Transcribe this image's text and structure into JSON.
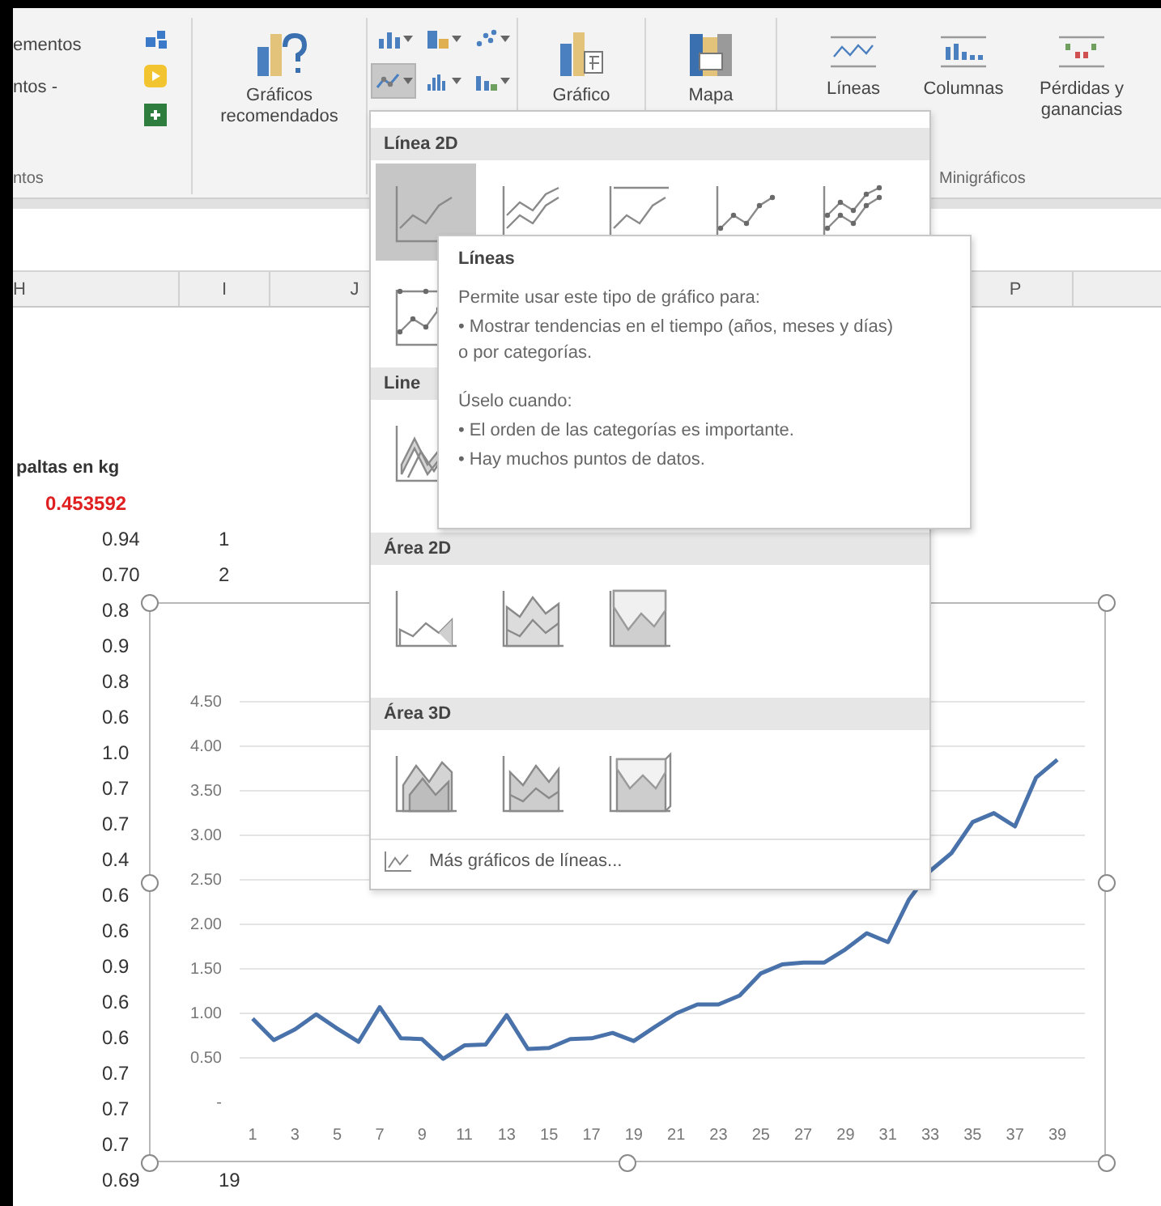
{
  "ribbon": {
    "partial_group": {
      "items": [
        "ementos",
        "ntos -"
      ],
      "label": "ntos"
    },
    "recommended_button": {
      "label": "Gráficos recomendados"
    },
    "chart_type_buttons": [
      {
        "kind": "column",
        "selected": false
      },
      {
        "kind": "hierarchy",
        "selected": false
      },
      {
        "kind": "scatter",
        "selected": false
      },
      {
        "kind": "line",
        "selected": true
      },
      {
        "kind": "statistic",
        "selected": false
      },
      {
        "kind": "combo",
        "selected": false
      }
    ],
    "pivot_chart_button": {
      "label": "Gráfico"
    },
    "map_button": {
      "label": "Mapa"
    },
    "sparklines": {
      "buttons": [
        {
          "kind": "line",
          "label": "Líneas"
        },
        {
          "kind": "column",
          "label": "Columnas"
        },
        {
          "kind": "win_loss",
          "label": "Pérdidas y ganancias"
        }
      ],
      "label": "Minigráficos"
    }
  },
  "column_headers": [
    "H",
    "I",
    "J",
    "P"
  ],
  "sheet": {
    "title_cell": "paltas en kg",
    "factor_cell": "0.453592",
    "rows": [
      {
        "value": "0.94",
        "number": "1"
      },
      {
        "value": "0.70",
        "number": "2"
      },
      {
        "value": "0.8"
      },
      {
        "value": "0.9"
      },
      {
        "value": "0.8"
      },
      {
        "value": "0.6"
      },
      {
        "value": "1.0"
      },
      {
        "value": "0.7"
      },
      {
        "value": "0.7"
      },
      {
        "value": "0.4"
      },
      {
        "value": "0.6"
      },
      {
        "value": "0.6"
      },
      {
        "value": "0.9"
      },
      {
        "value": "0.6"
      },
      {
        "value": "0.6"
      },
      {
        "value": "0.7"
      },
      {
        "value": "0.7"
      },
      {
        "value": "0.7"
      },
      {
        "value": "0.69",
        "number": "19"
      }
    ]
  },
  "chart": {
    "chart_data": {
      "type": "line",
      "x": [
        1,
        2,
        3,
        4,
        5,
        6,
        7,
        8,
        9,
        10,
        11,
        12,
        13,
        14,
        15,
        16,
        17,
        18,
        19,
        20,
        21,
        22,
        23,
        24,
        25,
        26,
        27,
        28,
        29,
        30,
        31,
        32,
        33,
        34,
        35,
        36,
        37,
        38,
        39
      ],
      "grid": true,
      "series": [
        {
          "color": "#4a72aa",
          "values": [
            0.94,
            0.7,
            0.82,
            0.99,
            0.83,
            0.68,
            1.07,
            0.72,
            0.71,
            0.49,
            0.64,
            0.65,
            0.98,
            0.6,
            0.61,
            0.71,
            0.72,
            0.78,
            0.69,
            0.85,
            1.0,
            1.1,
            1.1,
            1.2,
            1.45,
            1.55,
            1.57,
            1.57,
            1.72,
            1.9,
            1.8,
            2.28,
            2.6,
            2.8,
            3.15,
            3.25,
            3.1,
            3.65,
            3.85
          ]
        }
      ],
      "xlim": [
        1,
        39
      ],
      "ylim": [
        0,
        4.5
      ],
      "yticks": [
        {
          "value": 0,
          "label": "-"
        },
        {
          "value": 0.5,
          "label": "0.50"
        },
        {
          "value": 1,
          "label": "1.00"
        },
        {
          "value": 1.5,
          "label": "1.50"
        },
        {
          "value": 2,
          "label": "2.00"
        },
        {
          "value": 2.5,
          "label": "2.50"
        },
        {
          "value": 3,
          "label": "3.00"
        },
        {
          "value": 3.5,
          "label": "3.50"
        },
        {
          "value": 4,
          "label": "4.00"
        },
        {
          "value": 4.5,
          "label": "4.50"
        }
      ],
      "xticks": [
        1,
        3,
        5,
        7,
        9,
        11,
        13,
        15,
        17,
        19,
        21,
        23,
        25,
        27,
        29,
        31,
        33,
        35,
        37,
        39
      ]
    }
  },
  "dropdown": {
    "sections": [
      {
        "title": "Línea 2D",
        "items": [
          {
            "kind": "line",
            "selected": true
          },
          {
            "kind": "stacked_line",
            "selected": false
          },
          {
            "kind": "full_line",
            "selected": false
          },
          {
            "kind": "line_markers",
            "selected": false
          },
          {
            "kind": "stacked_markers",
            "selected": false
          },
          {
            "kind": "full_markers",
            "selected": false
          }
        ]
      },
      {
        "title": "Line",
        "items": [
          {
            "kind": "line3d",
            "selected": false
          }
        ]
      },
      {
        "title": "Área 2D",
        "items": [
          {
            "kind": "area",
            "selected": false
          },
          {
            "kind": "stacked_area",
            "selected": false
          },
          {
            "kind": "full_area",
            "selected": false
          }
        ]
      },
      {
        "title": "Área 3D",
        "items": [
          {
            "kind": "area3d",
            "selected": false
          },
          {
            "kind": "stacked_area3d",
            "selected": false
          },
          {
            "kind": "full_area3d",
            "selected": false
          }
        ]
      }
    ],
    "more_link": "Más gráficos de líneas..."
  },
  "tooltip": {
    "title": "Líneas",
    "lines": [
      "Permite usar este tipo de gráfico para:",
      "• Mostrar tendencias en el tiempo (años, meses y días) o por categorías.",
      "Úselo cuando:",
      "• El orden de las categorías es importante.",
      "• Hay muchos puntos de datos."
    ]
  }
}
